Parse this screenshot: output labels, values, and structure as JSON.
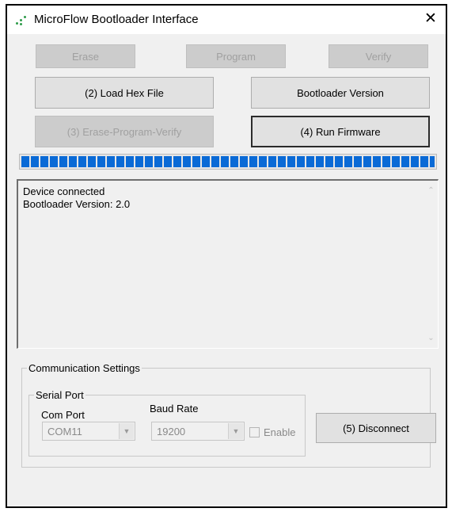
{
  "window": {
    "title": "MicroFlow Bootloader Interface",
    "close_label": "✕"
  },
  "buttons": {
    "erase": "Erase",
    "program": "Program",
    "verify": "Verify",
    "load_hex": "(2) Load Hex File",
    "bootloader_version": "Bootloader Version",
    "erase_program_verify": "(3) Erase-Program-Verify",
    "run_firmware": "(4) Run Firmware",
    "disconnect": "(5) Disconnect"
  },
  "progress": {
    "value": 1.0,
    "color": "#0a6ad6"
  },
  "log": {
    "lines": [
      "Device connected",
      "Bootloader Version: 2.0"
    ]
  },
  "communication": {
    "group_title": "Communication Settings",
    "serial_port": {
      "group_title": "Serial Port",
      "com_port_label": "Com Port",
      "com_port_value": "COM11",
      "baud_rate_label": "Baud Rate",
      "baud_rate_value": "19200",
      "enable_label": "Enable",
      "enable_checked": false
    }
  }
}
